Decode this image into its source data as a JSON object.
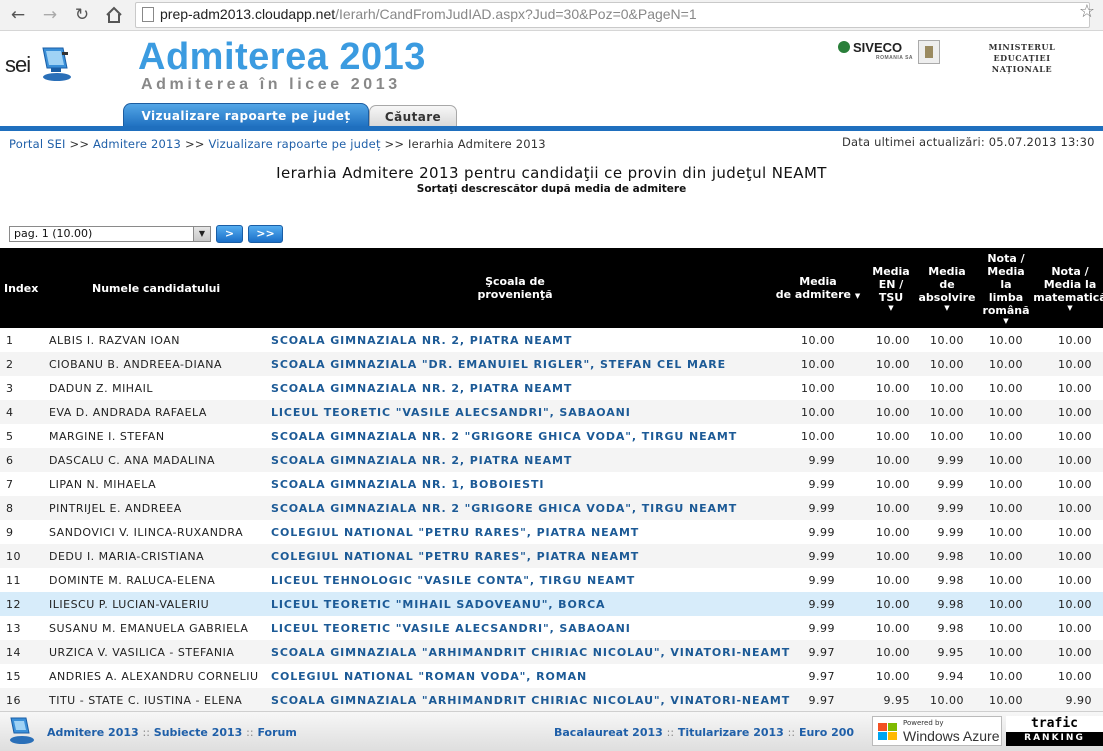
{
  "browser": {
    "url_host": "prep-adm2013.cloudapp.net",
    "url_path": "/Ierarh/CandFromJudIAD.aspx?Jud=30&Poz=0&PageN=1"
  },
  "header": {
    "logo_text": "sei",
    "title": "Admiterea 2013",
    "subtitle": "Admiterea în licee 2013",
    "siveco": "SIVECO",
    "siveco_tag": "ROMANIA SA",
    "ministry_line1": "MINISTERUL EDUCAȚIEI",
    "ministry_line2": "NAȚIONALE"
  },
  "tabs": {
    "active": "Vizualizare rapoarte pe județ",
    "inactive": "Căutare"
  },
  "breadcrumb": {
    "items": [
      "Portal SEI",
      "Admitere 2013",
      "Vizualizare rapoarte pe județ"
    ],
    "separator": ">>",
    "current": "Ierarhia Admitere 2013"
  },
  "updated": "Data ultimei actualizări: 05.07.2013 13:30",
  "heading": "Ierarhia Admitere 2013 pentru candidaţii ce provin din judeţul NEAMT",
  "subheading": "Sortaţi descrescător după media de admitere",
  "pager": {
    "selected": "pag. 1 (10.00)",
    "next_label": ">",
    "last_label": ">>"
  },
  "columns": {
    "index": "Index",
    "name": "Numele candidatului",
    "school_1": "Şcoala de",
    "school_2": "provenienţă",
    "media_1": "Media",
    "media_2": "de admitere",
    "en_1": "Media",
    "en_2": "EN /",
    "en_3": "TSU",
    "abs_1": "Media",
    "abs_2": "de",
    "abs_3": "absolvire",
    "ro_1": "Nota /",
    "ro_2": "Media",
    "ro_3": "la",
    "ro_4": "limba",
    "ro_5": "română",
    "mat_1": "Nota /",
    "mat_2": "Media la",
    "mat_3": "matematică"
  },
  "rows": [
    {
      "idx": "1",
      "name": "ALBIS I. RAZVAN IOAN",
      "school": "SCOALA GIMNAZIALA NR. 2, PIATRA NEAMT",
      "media": "10.00",
      "en": "10.00",
      "abs": "10.00",
      "ro": "10.00",
      "mat": "10.00"
    },
    {
      "idx": "2",
      "name": "CIOBANU B. ANDREEA-DIANA",
      "school": "SCOALA GIMNAZIALA \"DR. EMANUIEL RIGLER\", STEFAN CEL MARE",
      "media": "10.00",
      "en": "10.00",
      "abs": "10.00",
      "ro": "10.00",
      "mat": "10.00"
    },
    {
      "idx": "3",
      "name": "DADUN Z. MIHAIL",
      "school": "SCOALA GIMNAZIALA NR. 2, PIATRA NEAMT",
      "media": "10.00",
      "en": "10.00",
      "abs": "10.00",
      "ro": "10.00",
      "mat": "10.00"
    },
    {
      "idx": "4",
      "name": "EVA D. ANDRADA RAFAELA",
      "school": "LICEUL TEORETIC \"VASILE ALECSANDRI\", SABAOANI",
      "media": "10.00",
      "en": "10.00",
      "abs": "10.00",
      "ro": "10.00",
      "mat": "10.00"
    },
    {
      "idx": "5",
      "name": "MARGINE I. STEFAN",
      "school": "SCOALA GIMNAZIALA NR. 2 \"GRIGORE GHICA VODA\", TIRGU NEAMT",
      "media": "10.00",
      "en": "10.00",
      "abs": "10.00",
      "ro": "10.00",
      "mat": "10.00"
    },
    {
      "idx": "6",
      "name": "DASCALU C. ANA MADALINA",
      "school": "SCOALA GIMNAZIALA NR. 2, PIATRA NEAMT",
      "media": "9.99",
      "en": "10.00",
      "abs": "9.99",
      "ro": "10.00",
      "mat": "10.00"
    },
    {
      "idx": "7",
      "name": "LIPAN N. MIHAELA",
      "school": "SCOALA GIMNAZIALA NR. 1, BOBOIESTI",
      "media": "9.99",
      "en": "10.00",
      "abs": "9.99",
      "ro": "10.00",
      "mat": "10.00"
    },
    {
      "idx": "8",
      "name": "PINTRIJEL E. ANDREEA",
      "school": "SCOALA GIMNAZIALA NR. 2 \"GRIGORE GHICA VODA\", TIRGU NEAMT",
      "media": "9.99",
      "en": "10.00",
      "abs": "9.99",
      "ro": "10.00",
      "mat": "10.00"
    },
    {
      "idx": "9",
      "name": "SANDOVICI V. ILINCA-RUXANDRA",
      "school": "COLEGIUL NATIONAL \"PETRU RARES\", PIATRA NEAMT",
      "media": "9.99",
      "en": "10.00",
      "abs": "9.99",
      "ro": "10.00",
      "mat": "10.00"
    },
    {
      "idx": "10",
      "name": "DEDU I. MARIA-CRISTIANA",
      "school": "COLEGIUL NATIONAL \"PETRU RARES\", PIATRA NEAMT",
      "media": "9.99",
      "en": "10.00",
      "abs": "9.98",
      "ro": "10.00",
      "mat": "10.00"
    },
    {
      "idx": "11",
      "name": "DOMINTE M. RALUCA-ELENA",
      "school": "LICEUL TEHNOLOGIC \"VASILE CONTA\", TIRGU NEAMT",
      "media": "9.99",
      "en": "10.00",
      "abs": "9.98",
      "ro": "10.00",
      "mat": "10.00"
    },
    {
      "idx": "12",
      "name": "ILIESCU P. LUCIAN-VALERIU",
      "school": "LICEUL TEORETIC \"MIHAIL SADOVEANU\", BORCA",
      "media": "9.99",
      "en": "10.00",
      "abs": "9.98",
      "ro": "10.00",
      "mat": "10.00"
    },
    {
      "idx": "13",
      "name": "SUSANU M. EMANUELA GABRIELA",
      "school": "LICEUL TEORETIC \"VASILE ALECSANDRI\", SABAOANI",
      "media": "9.99",
      "en": "10.00",
      "abs": "9.98",
      "ro": "10.00",
      "mat": "10.00"
    },
    {
      "idx": "14",
      "name": "URZICA V. VASILICA - STEFANIA",
      "school": "SCOALA GIMNAZIALA \"ARHIMANDRIT CHIRIAC NICOLAU\", VINATORI-NEAMT",
      "media": "9.97",
      "en": "10.00",
      "abs": "9.95",
      "ro": "10.00",
      "mat": "10.00"
    },
    {
      "idx": "15",
      "name": "ANDRIES A. ALEXANDRU CORNELIU",
      "school": "COLEGIUL NATIONAL \"ROMAN VODA\", ROMAN",
      "media": "9.97",
      "en": "10.00",
      "abs": "9.94",
      "ro": "10.00",
      "mat": "10.00"
    },
    {
      "idx": "16",
      "name": "TITU - STATE C. IUSTINA - ELENA",
      "school": "SCOALA GIMNAZIALA \"ARHIMANDRIT CHIRIAC NICOLAU\", VINATORI-NEAMT",
      "media": "9.97",
      "en": "9.95",
      "abs": "10.00",
      "ro": "10.00",
      "mat": "9.90"
    }
  ],
  "footer": {
    "left": [
      "Admitere 2013",
      "Subiecte 2013",
      "Forum"
    ],
    "right": [
      "Bacalaureat 2013",
      "Titularizare 2013",
      "Euro 200"
    ],
    "separator": "::",
    "azure_small": "Powered by",
    "azure_big": "Windows Azure",
    "trafic": "trafic",
    "ranking": "RANKING"
  }
}
